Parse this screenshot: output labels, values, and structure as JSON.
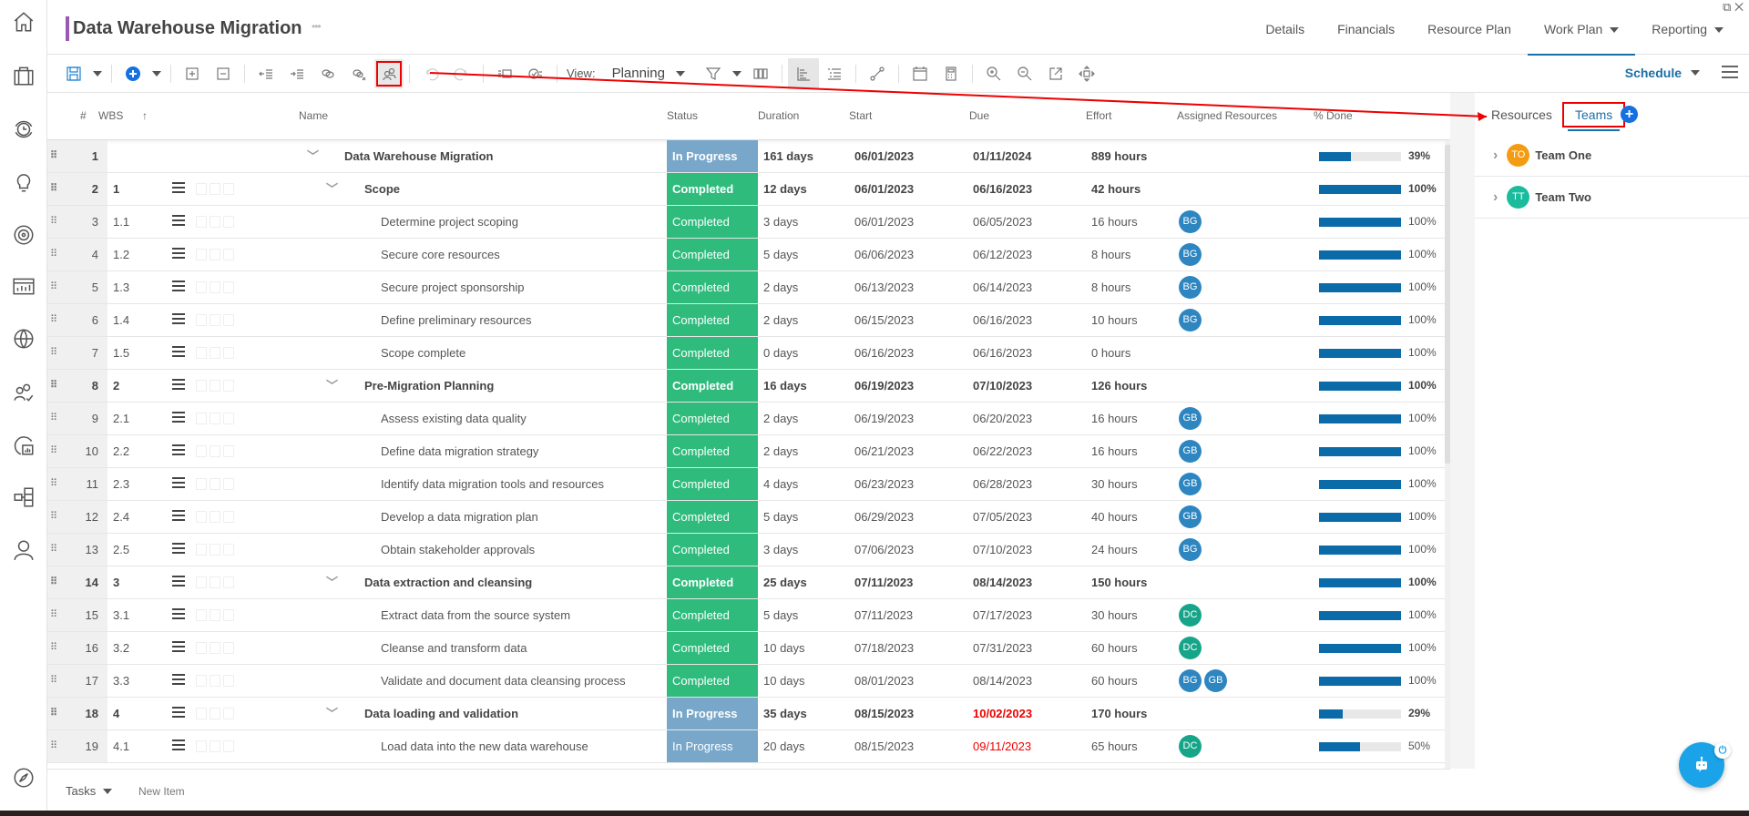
{
  "header": {
    "title": "Data Warehouse Migration",
    "more": "•••",
    "nav": [
      {
        "label": "Details",
        "dropdown": false,
        "active": false
      },
      {
        "label": "Financials",
        "dropdown": false,
        "active": false
      },
      {
        "label": "Resource Plan",
        "dropdown": false,
        "active": false
      },
      {
        "label": "Work Plan",
        "dropdown": true,
        "active": true
      },
      {
        "label": "Reporting",
        "dropdown": true,
        "active": false
      }
    ]
  },
  "rail": [
    "home-icon",
    "briefcase-icon",
    "timesheet-icon",
    "idea-icon",
    "target-icon",
    "dashboard-icon",
    "globe-icon",
    "team-icon",
    "report-icon",
    "hierarchy-icon",
    "user-icon",
    "compass-icon"
  ],
  "toolbar": {
    "view_label": "View:",
    "view_value": "Planning",
    "schedule_label": "Schedule",
    "highlighted_button": "assign-team-icon"
  },
  "columns": {
    "num": "#",
    "wbs": "WBS",
    "name": "Name",
    "status": "Status",
    "duration": "Duration",
    "start": "Start",
    "due": "Due",
    "effort": "Effort",
    "resources": "Assigned Resources",
    "done": "% Done"
  },
  "colors": {
    "completed": "#2ebb7c",
    "in_progress": "#78a7c9",
    "progress_fill": "#0b6aa8",
    "late": "#ee0000",
    "avatar_bg": "#2e86c1",
    "avatar_dc": "#17a589",
    "team_one": "#f39c12",
    "team_two": "#1abc9c"
  },
  "rows": [
    {
      "num": "1",
      "wbs": "",
      "name": "Data Warehouse Migration",
      "level": 0,
      "summary": true,
      "status": "In Progress",
      "duration": "161 days",
      "start": "06/01/2023",
      "due": "01/11/2024",
      "late": false,
      "effort": "889 hours",
      "resources": [],
      "done": 39,
      "done_label": "39%"
    },
    {
      "num": "2",
      "wbs": "1",
      "name": "Scope",
      "level": 1,
      "summary": true,
      "status": "Completed",
      "duration": "12 days",
      "start": "06/01/2023",
      "due": "06/16/2023",
      "late": false,
      "effort": "42 hours",
      "resources": [],
      "done": 100,
      "done_label": "100%"
    },
    {
      "num": "3",
      "wbs": "1.1",
      "name": "Determine project scoping",
      "level": 2,
      "summary": false,
      "status": "Completed",
      "duration": "3 days",
      "start": "06/01/2023",
      "due": "06/05/2023",
      "late": false,
      "effort": "16 hours",
      "resources": [
        "BG"
      ],
      "done": 100,
      "done_label": "100%"
    },
    {
      "num": "4",
      "wbs": "1.2",
      "name": "Secure core resources",
      "level": 2,
      "summary": false,
      "status": "Completed",
      "duration": "5 days",
      "start": "06/06/2023",
      "due": "06/12/2023",
      "late": false,
      "effort": "8 hours",
      "resources": [
        "BG"
      ],
      "done": 100,
      "done_label": "100%"
    },
    {
      "num": "5",
      "wbs": "1.3",
      "name": "Secure project sponsorship",
      "level": 2,
      "summary": false,
      "status": "Completed",
      "duration": "2 days",
      "start": "06/13/2023",
      "due": "06/14/2023",
      "late": false,
      "effort": "8 hours",
      "resources": [
        "BG"
      ],
      "done": 100,
      "done_label": "100%"
    },
    {
      "num": "6",
      "wbs": "1.4",
      "name": "Define preliminary resources",
      "level": 2,
      "summary": false,
      "status": "Completed",
      "duration": "2 days",
      "start": "06/15/2023",
      "due": "06/16/2023",
      "late": false,
      "effort": "10 hours",
      "resources": [
        "BG"
      ],
      "done": 100,
      "done_label": "100%"
    },
    {
      "num": "7",
      "wbs": "1.5",
      "name": "Scope complete",
      "level": 2,
      "summary": false,
      "status": "Completed",
      "duration": "0 days",
      "start": "06/16/2023",
      "due": "06/16/2023",
      "late": false,
      "effort": "0 hours",
      "resources": [],
      "done": 100,
      "done_label": "100%"
    },
    {
      "num": "8",
      "wbs": "2",
      "name": "Pre-Migration Planning",
      "level": 1,
      "summary": true,
      "status": "Completed",
      "duration": "16 days",
      "start": "06/19/2023",
      "due": "07/10/2023",
      "late": false,
      "effort": "126 hours",
      "resources": [],
      "done": 100,
      "done_label": "100%"
    },
    {
      "num": "9",
      "wbs": "2.1",
      "name": "Assess existing data quality",
      "level": 2,
      "summary": false,
      "status": "Completed",
      "duration": "2 days",
      "start": "06/19/2023",
      "due": "06/20/2023",
      "late": false,
      "effort": "16 hours",
      "resources": [
        "GB"
      ],
      "done": 100,
      "done_label": "100%"
    },
    {
      "num": "10",
      "wbs": "2.2",
      "name": "Define data migration strategy",
      "level": 2,
      "summary": false,
      "status": "Completed",
      "duration": "2 days",
      "start": "06/21/2023",
      "due": "06/22/2023",
      "late": false,
      "effort": "16 hours",
      "resources": [
        "GB"
      ],
      "done": 100,
      "done_label": "100%"
    },
    {
      "num": "11",
      "wbs": "2.3",
      "name": "Identify data migration tools and resources",
      "level": 2,
      "summary": false,
      "status": "Completed",
      "duration": "4 days",
      "start": "06/23/2023",
      "due": "06/28/2023",
      "late": false,
      "effort": "30 hours",
      "resources": [
        "GB"
      ],
      "done": 100,
      "done_label": "100%"
    },
    {
      "num": "12",
      "wbs": "2.4",
      "name": "Develop a data migration plan",
      "level": 2,
      "summary": false,
      "status": "Completed",
      "duration": "5 days",
      "start": "06/29/2023",
      "due": "07/05/2023",
      "late": false,
      "effort": "40 hours",
      "resources": [
        "GB"
      ],
      "done": 100,
      "done_label": "100%"
    },
    {
      "num": "13",
      "wbs": "2.5",
      "name": "Obtain stakeholder approvals",
      "level": 2,
      "summary": false,
      "status": "Completed",
      "duration": "3 days",
      "start": "07/06/2023",
      "due": "07/10/2023",
      "late": false,
      "effort": "24 hours",
      "resources": [
        "BG"
      ],
      "done": 100,
      "done_label": "100%"
    },
    {
      "num": "14",
      "wbs": "3",
      "name": "Data extraction and cleansing",
      "level": 1,
      "summary": true,
      "status": "Completed",
      "duration": "25 days",
      "start": "07/11/2023",
      "due": "08/14/2023",
      "late": false,
      "effort": "150 hours",
      "resources": [],
      "done": 100,
      "done_label": "100%"
    },
    {
      "num": "15",
      "wbs": "3.1",
      "name": "Extract data from the source system",
      "level": 2,
      "summary": false,
      "status": "Completed",
      "duration": "5 days",
      "start": "07/11/2023",
      "due": "07/17/2023",
      "late": false,
      "effort": "30 hours",
      "resources": [
        "DC"
      ],
      "done": 100,
      "done_label": "100%"
    },
    {
      "num": "16",
      "wbs": "3.2",
      "name": "Cleanse and transform data",
      "level": 2,
      "summary": false,
      "status": "Completed",
      "duration": "10 days",
      "start": "07/18/2023",
      "due": "07/31/2023",
      "late": false,
      "effort": "60 hours",
      "resources": [
        "DC"
      ],
      "done": 100,
      "done_label": "100%"
    },
    {
      "num": "17",
      "wbs": "3.3",
      "name": "Validate and document data cleansing process",
      "level": 2,
      "summary": false,
      "status": "Completed",
      "duration": "10 days",
      "start": "08/01/2023",
      "due": "08/14/2023",
      "late": false,
      "effort": "60 hours",
      "resources": [
        "BG",
        "GB"
      ],
      "done": 100,
      "done_label": "100%"
    },
    {
      "num": "18",
      "wbs": "4",
      "name": "Data loading and validation",
      "level": 1,
      "summary": true,
      "status": "In Progress",
      "duration": "35 days",
      "start": "08/15/2023",
      "due": "10/02/2023",
      "late": true,
      "effort": "170 hours",
      "resources": [],
      "done": 29,
      "done_label": "29%"
    },
    {
      "num": "19",
      "wbs": "4.1",
      "name": "Load data into the new data warehouse",
      "level": 2,
      "summary": false,
      "status": "In Progress",
      "duration": "20 days",
      "start": "08/15/2023",
      "due": "09/11/2023",
      "late": true,
      "effort": "65 hours",
      "resources": [
        "DC"
      ],
      "done": 50,
      "done_label": "50%"
    }
  ],
  "panel": {
    "tab_resources": "Resources",
    "tab_teams": "Teams",
    "teams": [
      {
        "initials": "TO",
        "name": "Team One"
      },
      {
        "initials": "TT",
        "name": "Team Two"
      }
    ]
  },
  "footer": {
    "tasks_label": "Tasks",
    "new_item": "New Item"
  }
}
